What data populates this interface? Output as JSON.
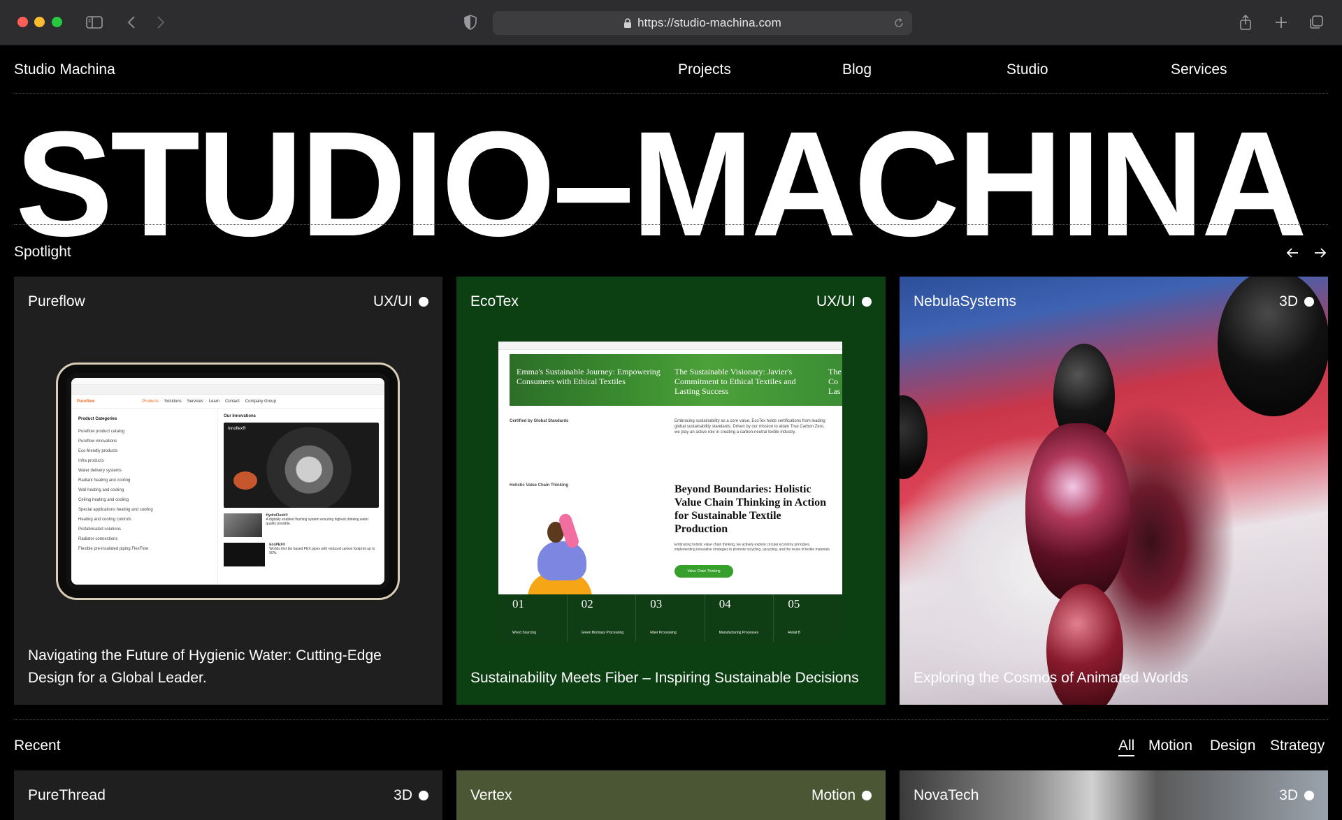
{
  "browser": {
    "url": "https://studio-machina.com"
  },
  "nav": {
    "brand": "Studio Machina",
    "links": [
      "Projects",
      "Blog",
      "Studio",
      "Services"
    ]
  },
  "hero": {
    "title": "STUDIO–MACHINA"
  },
  "spotlight": {
    "label": "Spotlight",
    "cards": [
      {
        "name": "Pureflow",
        "tag": "UX/UI",
        "caption": "Navigating the Future of Hygienic Water: Cutting-Edge Design for a Global Leader.",
        "bg": "#1f1f1f"
      },
      {
        "name": "EcoTex",
        "tag": "UX/UI",
        "caption": "Sustainability Meets Fiber – Inspiring Sustainable Decisions",
        "bg": "#0c3f12"
      },
      {
        "name": "NebulaSystems",
        "tag": "3D",
        "caption": "Exploring the Cosmos of Animated Worlds",
        "bg": "#d63a4f"
      }
    ]
  },
  "pureflow_mock": {
    "brand": "Pureflow",
    "menu": [
      "Products",
      "Solutions",
      "Services",
      "Learn",
      "Contact",
      "Company Group"
    ],
    "left_title": "Product Categories",
    "left_items": [
      "Pureflow product catalog",
      "Pureflow innovations",
      "Eco-friendly products",
      "Infra products",
      "Water delivery systems",
      "Radiant heating and cooling",
      "Wall heating and cooling",
      "Ceiling heating and cooling",
      "Special applications heating and cooling",
      "Heating and cooling controls",
      "Prefabricated solutions",
      "Radiator connections",
      "Flexible pre-insulated piping FlexFlow"
    ],
    "right_title": "Our Innovations",
    "feature_title": "Innoflex®",
    "item1_title": "HydroFlush®",
    "item1_text": "A digitally enabled flushing system ensuring highest drinking water quality possible.",
    "item2_title": "EcoPEX®",
    "item2_text": "Worlds first bio based PEX pipes with reduced carbon footprint up to 50%."
  },
  "ecotex_mock": {
    "hero_left": "Emma's Sustainable Journey: Empowering Consumers with Ethical Textiles",
    "hero_mid": "The Sustainable Visionary: Javier's Commitment to Ethical Textiles and Lasting Success",
    "hero_right": "The Co Las",
    "certified": "Certified by Global Standards",
    "cert_text": "Embracing sustainability as a core value, EcoTex holds certifications from leading global sustainability standards. Driven by our mission to attain True Carbon Zero, we play an active role in creating a carbon-neutral textile industry.",
    "chain_label": "Holistic Value Chain Thinking",
    "heading": "Beyond Boundaries: Holistic Value Chain Thinking in Action for Sustainable Textile Production",
    "body": "Embracing holistic value chain thinking, we actively explore circular economy principles, implementing innovative strategies to promote recycling, upcycling, and the reuse of textile materials.",
    "button": "Value Chain Thinking",
    "steps": [
      {
        "num": "01",
        "label": "Wood Sourcing"
      },
      {
        "num": "02",
        "label": "Green Biomass Processing"
      },
      {
        "num": "03",
        "label": "Fiber Processing"
      },
      {
        "num": "04",
        "label": "Manufacturing Processes"
      },
      {
        "num": "05",
        "label": "Retail B"
      }
    ]
  },
  "recent": {
    "label": "Recent",
    "filters": [
      "All",
      "Motion",
      "Design",
      "Strategy"
    ],
    "active_filter": "All",
    "cards": [
      {
        "name": "PureThread",
        "tag": "3D",
        "bg": "#1f1f1f"
      },
      {
        "name": "Vertex",
        "tag": "Motion",
        "bg": "#4a5634"
      },
      {
        "name": "NovaTech",
        "tag": "3D",
        "bg": "#6b6b6b"
      }
    ]
  },
  "icons": [
    "sidebar-icon",
    "back-icon",
    "forward-icon",
    "shield-icon",
    "lock-icon",
    "reload-icon",
    "share-icon",
    "new-tab-icon",
    "tabs-icon",
    "arrow-left-icon",
    "arrow-right-icon"
  ]
}
